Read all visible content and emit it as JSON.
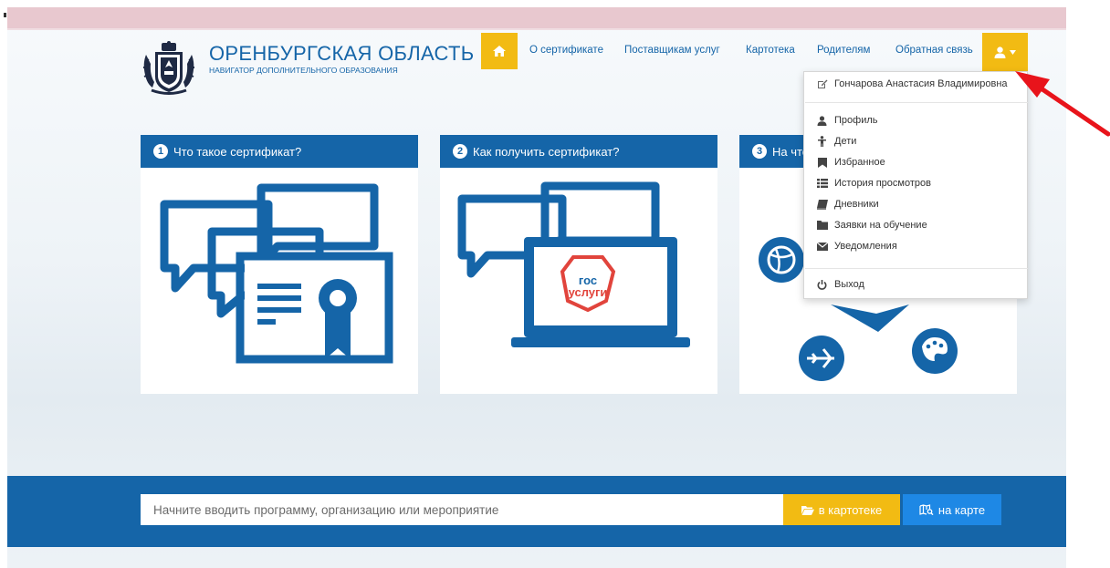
{
  "header": {
    "title": "ОРЕНБУРГСКАЯ ОБЛАСТЬ",
    "subtitle": "НАВИГАТОР ДОПОЛНИТЕЛЬНОГО ОБРАЗОВАНИЯ"
  },
  "nav": {
    "home_icon": "home-icon",
    "links": [
      "О сертификате",
      "Поставщикам услуг",
      "Картотека",
      "Родителям",
      "Обратная связь"
    ],
    "user_icon": "user-icon"
  },
  "cards": [
    {
      "number": "1",
      "title": "Что такое сертификат?"
    },
    {
      "number": "2",
      "title": "Как получить сертификат?",
      "badge_line1": "гос",
      "badge_line2": "услуги"
    },
    {
      "number": "3",
      "title": "На что потратить сертификат?"
    }
  ],
  "user_menu": {
    "user_name": "Гончарова Анастасия Владимировна",
    "items": [
      {
        "label": "Профиль",
        "icon": "user-icon"
      },
      {
        "label": "Дети",
        "icon": "child-icon"
      },
      {
        "label": "Избранное",
        "icon": "bookmark-icon"
      },
      {
        "label": "История просмотров",
        "icon": "list-icon"
      },
      {
        "label": "Дневники",
        "icon": "book-icon"
      },
      {
        "label": "Заявки на обучение",
        "icon": "folder-icon"
      },
      {
        "label": "Уведомления",
        "icon": "envelope-icon"
      }
    ],
    "logout": "Выход"
  },
  "search": {
    "placeholder": "Начните вводить программу, организацию или мероприятие",
    "catalog_button": "в картотеке",
    "map_button": "на карте"
  },
  "colors": {
    "primary": "#1565a8",
    "accent": "#f2bb13",
    "map_button": "#1e88e5",
    "annotation_arrow": "#e8141b"
  }
}
